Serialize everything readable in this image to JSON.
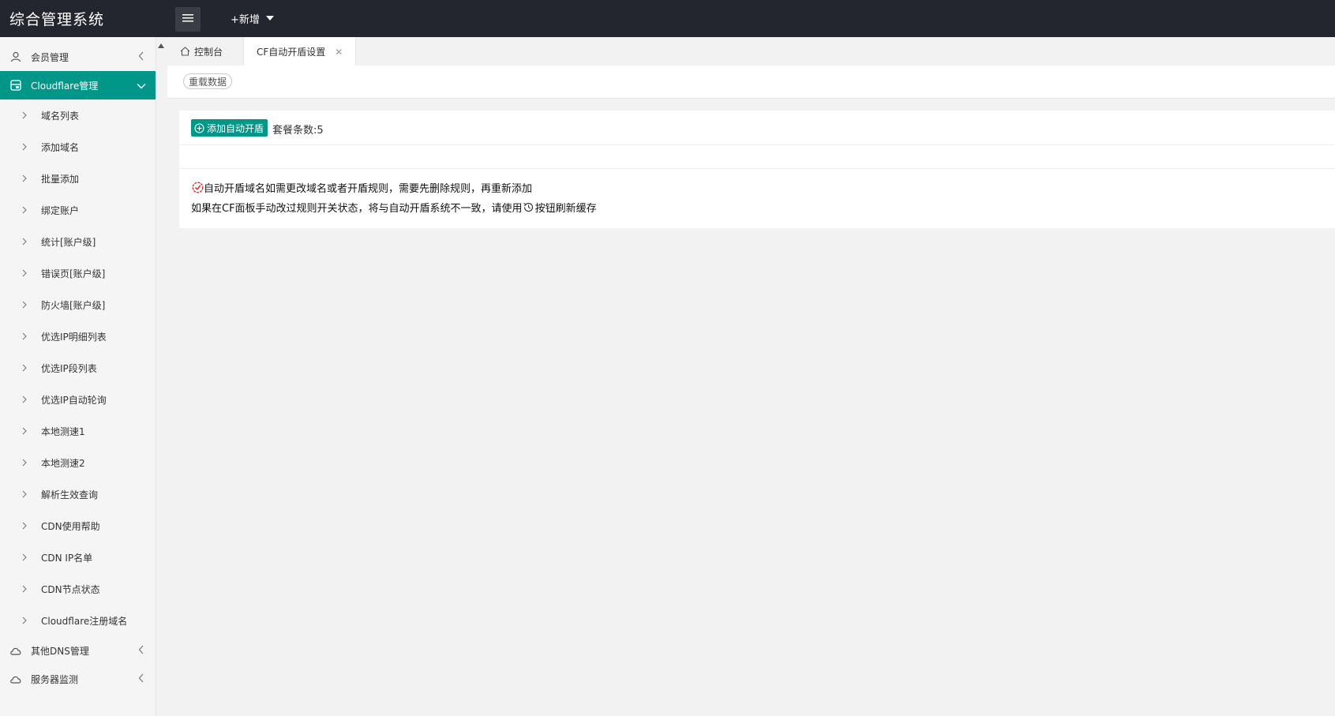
{
  "header": {
    "app_title": "综合管理系统",
    "new_menu_label": "+新增"
  },
  "sidebar": {
    "groups": [
      {
        "label": "会员管理",
        "icon": "user-icon",
        "expanded": false
      },
      {
        "label": "Cloudflare管理",
        "icon": "server-icon",
        "expanded": true
      },
      {
        "label": "其他DNS管理",
        "icon": "cloud-icon",
        "expanded": false
      },
      {
        "label": "服务器监测",
        "icon": "cloud-icon",
        "expanded": false
      }
    ],
    "cloudflare_items": [
      "域名列表",
      "添加域名",
      "批量添加",
      "绑定账户",
      "统计[账户级]",
      "错误页[账户级]",
      "防火墙[账户级]",
      "优选IP明细列表",
      "优选IP段列表",
      "优选IP自动轮询",
      "本地测速1",
      "本地测速2",
      "解析生效查询",
      "CDN使用帮助",
      "CDN IP名单",
      "CDN节点状态",
      "Cloudflare注册域名"
    ]
  },
  "tabs": {
    "home_label": "控制台",
    "current_label": "CF自动开盾设置",
    "close_symbol": "✕"
  },
  "toolbar": {
    "reload_label": "重载数据"
  },
  "card": {
    "add_button_label": "添加自动开盾",
    "plan_count_text": "套餐条数:5",
    "notice_line1": "自动开盾域名如需更改域名或者开盾规则，需要先删除规则，再重新添加",
    "notice_line2_before": "如果在CF面板手动改过规则开关状态，将与自动开盾系统不一致，请使用",
    "notice_line2_after": "按钮刷新缓存"
  },
  "colors": {
    "header_bg": "#23262e",
    "accent": "#009688",
    "warning_icon": "#e02020"
  }
}
